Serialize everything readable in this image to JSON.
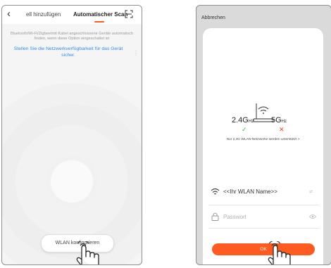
{
  "left_screen": {
    "tab_manual": "ell hinzufügen",
    "tab_auto": "Automatischer Scan",
    "description": "Bluetooth/Wi-Fi/Zigbee/mit Kabel angeschlossene Geräte automatisch finden, wenn diese Option eingeschaltet ist",
    "network_link": "Stellen Sie die Netzwerkverfügbarkeit für das Gerät sicher.",
    "configure_button": "WLAN konfigurieren",
    "icons": [
      "back-icon",
      "scan-icon",
      "radar-waves",
      "hand-pointer-icon"
    ]
  },
  "right_screen": {
    "cancel": "Abbrechen",
    "band_24": "2.4G",
    "band_24_unit": "Hz",
    "band_5": "5G",
    "band_5_unit": "Hz",
    "band_24_status": "✓",
    "band_5_status": "✕",
    "note": "Nur 2,4G WLAN-Netzwerke werden unterstützt >",
    "ssid_value": "<<Ihr WLAN Name>>",
    "password_placeholder": "Passwort",
    "ok_button": "OK",
    "icons": [
      "router-icon",
      "wifi-icon",
      "swap-icon",
      "lock-icon",
      "eye-icon",
      "hand-pointer-icon"
    ]
  },
  "colors": {
    "accent": "#ff5a1f",
    "link": "#2f8de4",
    "success": "#2fb84b",
    "error": "#e8473a"
  }
}
